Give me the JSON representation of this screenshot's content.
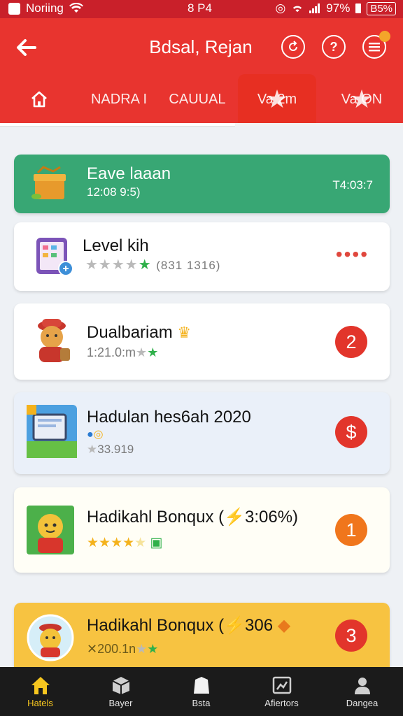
{
  "status_bar": {
    "carrier": "Noriing",
    "time": "8 P4",
    "battery_pct": "97%",
    "battery_box": "B5%"
  },
  "header": {
    "title": "Bdsal, Rejan",
    "back_icon": "back-arrow-icon",
    "actions": [
      "refresh-icon",
      "help-icon",
      "menu-icon"
    ]
  },
  "tabs": [
    {
      "label": "",
      "icon": "home-icon"
    },
    {
      "label": "NADRA I"
    },
    {
      "label": "CAUUAL"
    },
    {
      "label": "Va 2m",
      "active": true
    },
    {
      "label": "Va ON"
    }
  ],
  "cards": [
    {
      "title": "Eave laaan",
      "subtitle": "12:08 9:5)",
      "right": "T4:03:7"
    },
    {
      "title": "Level kih",
      "subtitle": "(831 1316)",
      "right": "••••"
    },
    {
      "title": "Dualbariam",
      "subtitle": "1:21.0:m",
      "badge": "2"
    },
    {
      "title": "Hadulan hes6ah 2020",
      "subtitle": "33.919",
      "badge": "$"
    },
    {
      "title": "Hadikahl Bonqux (⚡3:06%)",
      "subtitle": "",
      "badge": "1"
    },
    {
      "title": "Hadikahl Bonqux (⚡306",
      "subtitle": "200.1n",
      "badge": "3"
    }
  ],
  "colors": {
    "red": "#e8342f",
    "green": "#38a774",
    "orange": "#f0761c",
    "yellow": "#f7c341"
  },
  "bottom_nav": [
    {
      "label": "Hatels",
      "icon": "home-icon",
      "active": true
    },
    {
      "label": "Bayer",
      "icon": "box-icon"
    },
    {
      "label": "Bsta",
      "icon": "bag-icon"
    },
    {
      "label": "Afiertors",
      "icon": "picture-icon"
    },
    {
      "label": "Dangea",
      "icon": "user-icon"
    }
  ]
}
